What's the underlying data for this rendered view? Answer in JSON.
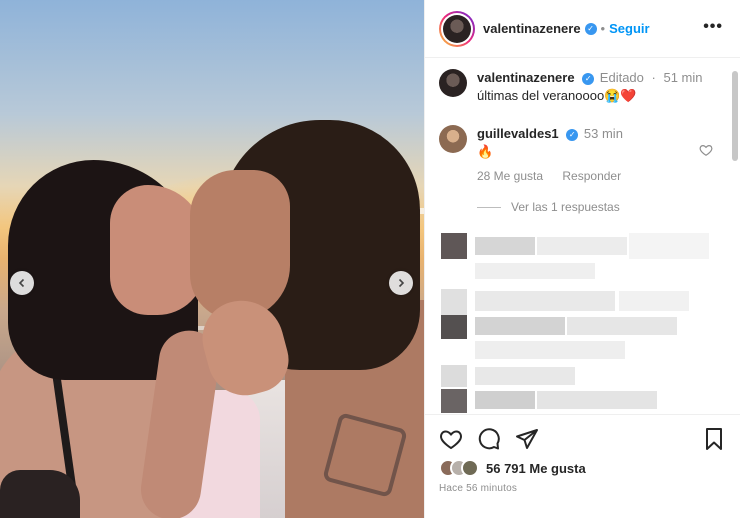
{
  "post": {
    "author": "valentinazenere",
    "follow_label": "Seguir",
    "separator": "•",
    "more_label": "•••"
  },
  "caption": {
    "author": "valentinazenere",
    "edited_label": "Editado",
    "time": "51 min",
    "text": "últimas del veranoooo😭❤️"
  },
  "comments": [
    {
      "author": "guillevaldes1",
      "time": "53 min",
      "text": "🔥",
      "likes_label": "28 Me gusta",
      "reply_label": "Responder",
      "view_replies_label": "Ver las 1 respuestas"
    }
  ],
  "actions": {
    "likes_label": "56 791 Me gusta",
    "timestamp": "Hace 56 minutos"
  },
  "icons": [
    "chevron-left-icon",
    "chevron-right-icon",
    "heart-icon",
    "comment-icon",
    "share-icon",
    "bookmark-icon",
    "more-icon",
    "verified-icon"
  ],
  "colors": {
    "accent": "#0095f6",
    "verified": "#3897f0",
    "muted": "#8e8e8e",
    "text": "#262626"
  }
}
